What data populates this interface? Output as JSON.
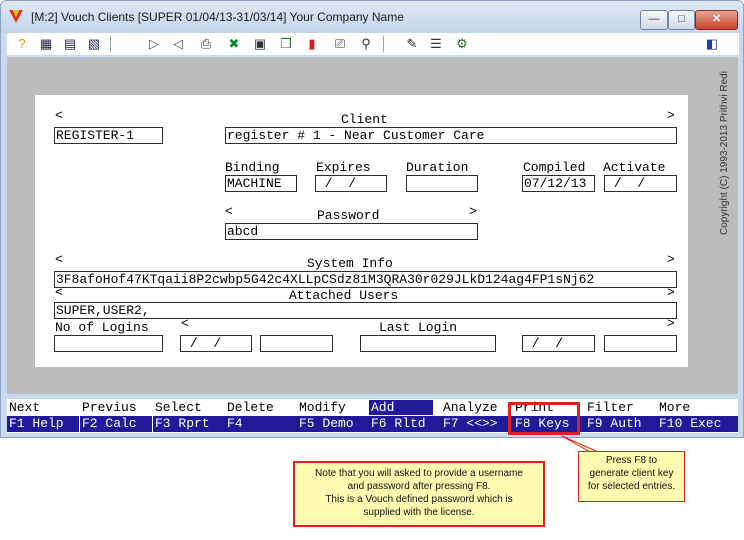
{
  "window": {
    "title": "[M:2]  Vouch Clients  [SUPER  01/04/13-31/03/14]  Your Company Name",
    "min_label": "—",
    "max_label": "□",
    "close_label": "✕"
  },
  "toolbar": {
    "icons": [
      "help-icon",
      "grid-icon",
      "table-icon",
      "report-icon",
      "play-icon",
      "back-icon",
      "print-setup-icon",
      "tools-icon",
      "image-icon",
      "copy-icon",
      "chart-icon",
      "printer-icon",
      "find-icon",
      "notes-icon",
      "list-icon",
      "settings-icon",
      "exit-icon"
    ]
  },
  "copyright": "Copyright (C) 1993-2013  Prithvi Redi",
  "form": {
    "arrow_left": "<",
    "arrow_right": ">",
    "client_label": "Client",
    "client_code": "REGISTER-1",
    "client_name": "register # 1 - Near Customer Care",
    "binding_label": "Binding",
    "binding_value": "MACHINE",
    "expires_label": "Expires",
    "expires_value": " /  /",
    "duration_label": "Duration",
    "duration_value": "",
    "compiled_label": "Compiled",
    "compiled_value": "07/12/13",
    "activate_label": "Activate",
    "activate_value": " /  /",
    "password_label": "Password",
    "password_value": "abcd",
    "system_info_label": "System Info",
    "system_info_value": "3F8afoHof47KTqaii8P2cwbp5G42c4XLLpCSdz81M3QRA30r029JLkD124ag4FP1sNj62",
    "attached_users_label": "Attached Users",
    "attached_users_value": "SUPER,USER2,",
    "no_of_logins_label": "No of Logins",
    "no_of_logins_value": "",
    "last_login_label": "Last Login",
    "last_login_date": " /  /",
    "last_login_time": "",
    "last_login_value": "",
    "last_date2": " /  /",
    "last_extra": ""
  },
  "fkeys": [
    {
      "top": "Next",
      "bottom": "F1 Help"
    },
    {
      "top": "Previus",
      "bottom": "F2 Calc"
    },
    {
      "top": "Select",
      "bottom": "F3 Rprt"
    },
    {
      "top": "Delete",
      "bottom": "F4"
    },
    {
      "top": "Modify",
      "bottom": "F5 Demo"
    },
    {
      "top": "Add",
      "bottom": "F6 Rltd"
    },
    {
      "top": "Analyze",
      "bottom": "F7 <<>>"
    },
    {
      "top": "Print",
      "bottom": "F8 Keys"
    },
    {
      "top": "Filter",
      "bottom": "F9 Auth"
    },
    {
      "top": "More",
      "bottom": "F10 Exec"
    }
  ],
  "callouts": {
    "note_lines": [
      "Note that you will asked to provide a username",
      "and password after pressing F8.",
      "This is a Vouch defined password which is",
      "supplied with the license."
    ],
    "f8_lines": [
      "Press F8 to",
      "generate client key",
      "for selected entries."
    ]
  },
  "colors": {
    "fkey_bar": "#1e1a9a",
    "highlight": "#e02020",
    "callout_bg": "#fffbb0",
    "client_bg": "#bcbcbc"
  }
}
